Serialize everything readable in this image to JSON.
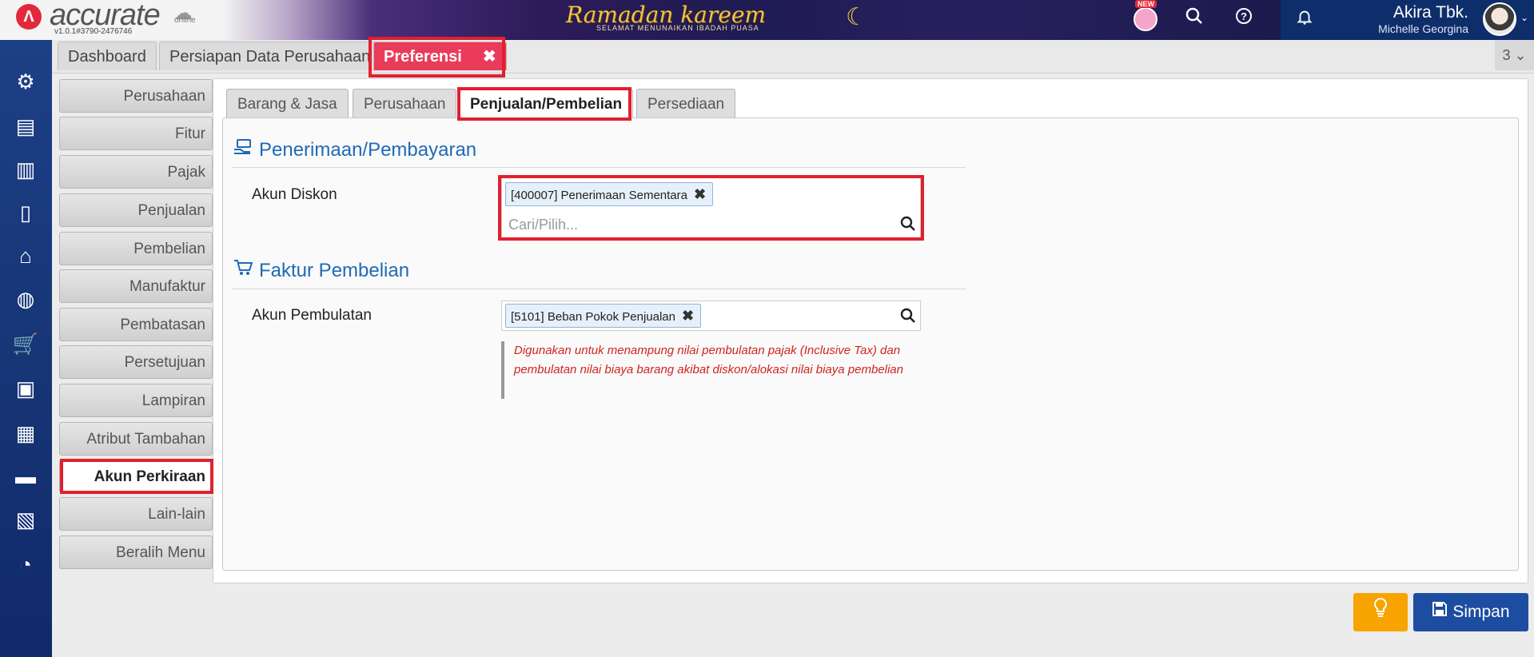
{
  "header": {
    "logo_text": "accurate",
    "logo_sub": "online",
    "version": "v1.0.1#3790-2476746",
    "banner_title": "Ramadan kareem",
    "banner_sub": "SELAMAT MENUNAIKAN IBADAH PUASA",
    "new_badge": "NEW",
    "user_name": "Akira Tbk.",
    "company_name": "Michelle Georgina"
  },
  "tabs": {
    "dashboard": "Dashboard",
    "persiapan": "Persiapan Data Perusahaan",
    "preferensi": "Preferensi",
    "close_glyph": "✖",
    "count": "3 ⌄"
  },
  "menu": {
    "items": [
      "Perusahaan",
      "Fitur",
      "Pajak",
      "Penjualan",
      "Pembelian",
      "Manufaktur",
      "Pembatasan",
      "Persetujuan",
      "Lampiran",
      "Atribut Tambahan",
      "Akun Perkiraan",
      "Lain-lain",
      "Beralih Menu"
    ],
    "active": "Akun Perkiraan"
  },
  "subtabs": {
    "items": [
      "Barang & Jasa",
      "Perusahaan",
      "Penjualan/Pembelian",
      "Persediaan"
    ],
    "active": "Penjualan/Pembelian"
  },
  "sections": {
    "penerimaan": {
      "title": "Penerimaan/Pembayaran",
      "icon": "payment-icon",
      "field_label": "Akun Diskon",
      "chip": "[400007] Penerimaan Sementara",
      "search_placeholder": "Cari/Pilih..."
    },
    "faktur": {
      "title": "Faktur Pembelian",
      "icon": "cart-icon",
      "field_label": "Akun Pembulatan",
      "chip": "[5101] Beban Pokok Penjualan",
      "note": "Digunakan untuk menampung nilai pembulatan pajak (Inclusive Tax) dan pembulatan nilai biaya barang akibat diskon/alokasi nilai biaya pembelian"
    }
  },
  "buttons": {
    "save": "Simpan"
  },
  "colors": {
    "accent": "#1f6ab7",
    "active_tab": "#ea3b5a",
    "save": "#1d4da1",
    "hint": "#f7a400",
    "highlight": "#e0202f",
    "note": "#d02420"
  }
}
